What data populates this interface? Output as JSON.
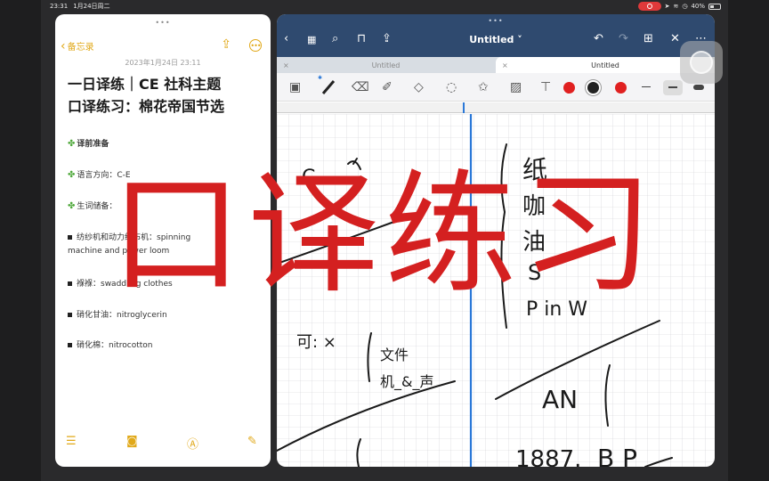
{
  "status_bar": {
    "time": "23:31",
    "date": "1月24日周二",
    "battery": "40%"
  },
  "notes": {
    "back_label": "备忘录",
    "date": "2023年1月24日 23:11",
    "title_line1": "一日译练｜CE 社科主题",
    "title_line2": "口译练习：棉花帝国节选",
    "lines": [
      {
        "text": "译前准备",
        "bold": true,
        "icon": "clover-icon"
      },
      {
        "text": "语言方向：C-E",
        "bold": false,
        "icon": "clover-icon"
      },
      {
        "text": "生词储备：",
        "bold": false,
        "icon": "clover-icon"
      },
      {
        "text": "纺纱机和动力织布机：spinning",
        "text2": "machine and power loom",
        "bold": false,
        "icon": "bullet"
      },
      {
        "text": "褓褓：swaddling clothes",
        "bold": false,
        "icon": "bullet"
      },
      {
        "text": "硝化甘油：nitroglycerin",
        "bold": false,
        "icon": "bullet"
      },
      {
        "text": "硝化棉：nitrocotton",
        "bold": false,
        "icon": "bullet"
      }
    ]
  },
  "goodnotes": {
    "title": "Untitled",
    "tabs": [
      {
        "label": "Untitled",
        "active": false
      },
      {
        "label": "Untitled",
        "active": true
      }
    ],
    "colors": {
      "red": "#e02020",
      "black": "#222222",
      "nav": "#2f4a6f",
      "marker": "#2a78d8"
    },
    "handwriting": {
      "left": [
        "C",
        "可: ×",
        "文件",
        "机_&_声"
      ],
      "right": [
        "纸",
        "咖",
        "油",
        "S",
        "P in W",
        "AN",
        "1887.",
        "B P"
      ]
    }
  },
  "overlay_title": "口译练习"
}
